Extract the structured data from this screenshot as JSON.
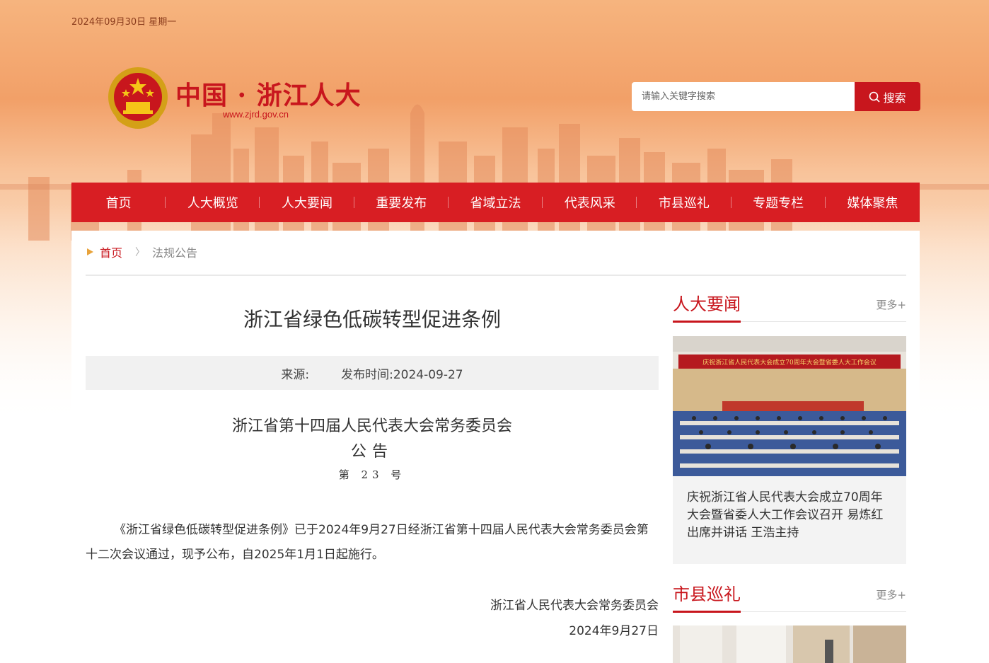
{
  "top": {
    "date": "2024年09月30日 星期一"
  },
  "header": {
    "site_title": "中国 · 浙江人大",
    "site_url": "www.zjrd.gov.cn",
    "search_placeholder": "请输入关键字搜索",
    "search_button": "搜索"
  },
  "nav": {
    "items": [
      "首页",
      "人大概览",
      "人大要闻",
      "重要发布",
      "省域立法",
      "代表风采",
      "市县巡礼",
      "专题专栏",
      "媒体聚焦"
    ]
  },
  "breadcrumb": {
    "home": "首页",
    "current": "法规公告"
  },
  "article": {
    "title": "浙江省绿色低碳转型促进条例",
    "source_label": "来源:",
    "publish_label": "发布时间:2024-09-27",
    "org": "浙江省第十四届人民代表大会常务委员会",
    "announcement": "公告",
    "number": "第 23 号",
    "body": "《浙江省绿色低碳转型促进条例》已于2024年9月27日经浙江省第十四届人民代表大会常务委员会第十二次会议通过，现予公布，自2025年1月1日起施行。",
    "signature_org": "浙江省人民代表大会常务委员会",
    "signature_date": "2024年9月27日"
  },
  "sidebar": {
    "section1": {
      "title": "人大要闻",
      "more": "更多+"
    },
    "news1": {
      "banner": "庆祝浙江省人民代表大会成立70周年大会暨省委人大工作会议",
      "caption": "庆祝浙江省人民代表大会成立70周年大会暨省委人大工作会议召开 易炼红出席并讲话 王浩主持"
    },
    "section2": {
      "title": "市县巡礼",
      "more": "更多+"
    }
  },
  "colors": {
    "brand_red": "#c8161d",
    "nav_red": "#d81e23"
  }
}
